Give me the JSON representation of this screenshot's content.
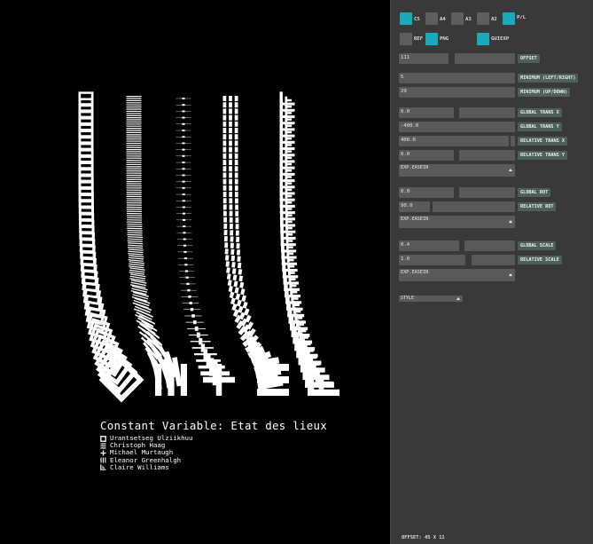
{
  "colors": {
    "canvas_bg": "#000000",
    "panel_bg": "#393939",
    "toggle_on": "#19aabb",
    "toggle_off": "#5e5e5e",
    "field_bg": "#5a5a5a",
    "tag_bg": "#4e5e5c"
  },
  "poster": {
    "title": "Constant Variable: Etat des lieux",
    "names": [
      {
        "icon": "square-outline-icon",
        "name": "Urantsetseg Ulziikhuu"
      },
      {
        "icon": "triple-bar-icon",
        "name": "Christoph Haag"
      },
      {
        "icon": "plus-icon",
        "name": "Michael Murtaugh"
      },
      {
        "icon": "vertical-bars-icon",
        "name": "Eleanor Greenhalgh"
      },
      {
        "icon": "corner-bracket-icon",
        "name": "Claire Williams"
      }
    ]
  },
  "panel": {
    "format_toggles": [
      {
        "label": "C5",
        "on": true
      },
      {
        "label": "A4",
        "on": false
      },
      {
        "label": "A3",
        "on": false
      },
      {
        "label": "A2",
        "on": false
      },
      {
        "label": "P/L",
        "on": true
      }
    ],
    "export_toggles": [
      {
        "label": "REF",
        "on": false
      },
      {
        "label": "PNG",
        "on": true
      },
      {
        "label": "GUIEXP",
        "on": true
      }
    ],
    "offset": {
      "value": "111",
      "label": "OFFSET"
    },
    "min_lr": {
      "value": "5",
      "label": "MINIMUM  (LEFT/RIGHT)"
    },
    "min_ud": {
      "value": "29",
      "label": "MINIMUM  (UP/DOWN)"
    },
    "global_trans_x": {
      "value": "0.0",
      "label": "GLOBAL TRANS X"
    },
    "global_trans_y": {
      "value": "-400.0",
      "label": "GLOBAL TRANS Y"
    },
    "relative_trans_x": {
      "value": "400.0",
      "label": "RELATIVE TRANS X"
    },
    "relative_trans_y": {
      "value": "0.0",
      "label": "RELATIVE TRANS Y"
    },
    "easing1": {
      "value": "EXP.EASEIN"
    },
    "global_rot": {
      "value": "0.0",
      "label": "GLOBAL ROT"
    },
    "relative_rot": {
      "value": "90.0",
      "label": "RELATIVE ROT"
    },
    "easing2": {
      "value": "EXP.EASEIN"
    },
    "global_scale": {
      "value": "0.4",
      "label": "GLOBAL SCALE"
    },
    "relative_scale": {
      "value": "1.0",
      "label": "RELATIVE SCALE"
    },
    "easing3": {
      "value": "EXP.EASEIN"
    },
    "style": {
      "value": "STYLE"
    },
    "status": "OFFSET: 45 X 11"
  }
}
